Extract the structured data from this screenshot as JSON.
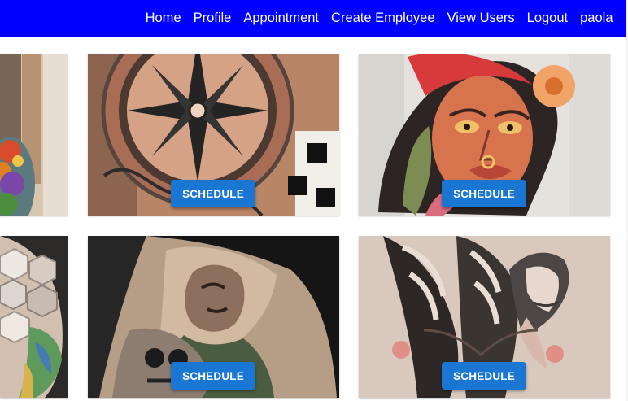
{
  "navbar": {
    "background": "#0000ff",
    "links": [
      {
        "label": "Home"
      },
      {
        "label": "Profile"
      },
      {
        "label": "Appointment"
      },
      {
        "label": "Create Employee"
      },
      {
        "label": "View Users"
      },
      {
        "label": "Logout"
      },
      {
        "label": "paola"
      }
    ]
  },
  "gallery": {
    "button_color": "#1976d2",
    "schedule_label": "SCHEDULE"
  }
}
